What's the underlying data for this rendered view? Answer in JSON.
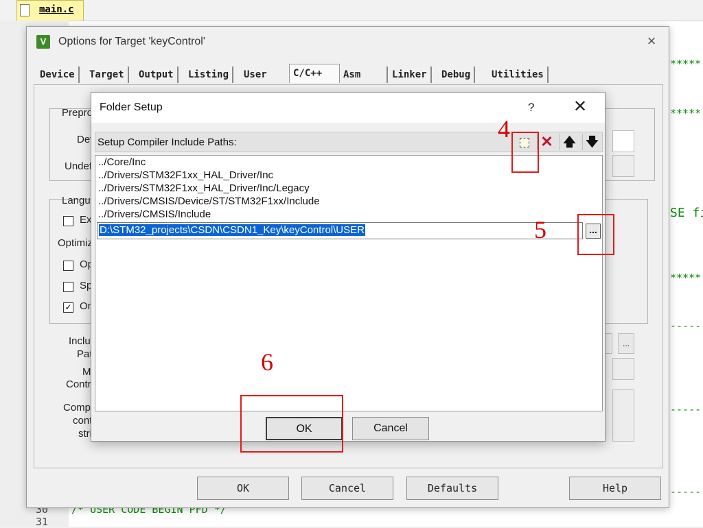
{
  "editor": {
    "file_tab": "main.c",
    "code_fragments": [
      "*****",
      "*****",
      "SE fi",
      "*****",
      "-----",
      "-----",
      "-----",
      "/* USER CODE BEGIN PFD */"
    ],
    "line_numbers": [
      "30",
      "31"
    ]
  },
  "options_dialog": {
    "title": "Options for Target 'keyControl'",
    "close_glyph": "×",
    "tabs": [
      "Device",
      "Target",
      "Output",
      "Listing",
      "User",
      "C/C++",
      "Asm",
      "Linker",
      "Debug",
      "Utilities"
    ],
    "active_tab": "C/C++",
    "bg_labels": [
      "Prepro",
      "Def",
      "Undef",
      "Langu",
      "Ex",
      "Optimiz",
      "Op",
      "Sp",
      "On",
      "Inclu",
      "Pat",
      "M",
      "Contr",
      "Comp",
      "cont",
      "stri"
    ],
    "bg_browse_glyph": "...",
    "buttons": {
      "ok": "OK",
      "cancel": "Cancel",
      "defaults": "Defaults",
      "help": "Help"
    }
  },
  "folder_setup": {
    "title": "Folder Setup",
    "help_glyph": "?",
    "close_glyph": "✕",
    "toolbar_label": "Setup Compiler Include Paths:",
    "toolbar_icons": [
      "new-folder-icon",
      "delete-icon",
      "move-up-icon",
      "move-down-icon"
    ],
    "paths": [
      "../Core/Inc",
      "../Drivers/STM32F1xx_HAL_Driver/Inc",
      "../Drivers/STM32F1xx_HAL_Driver/Inc/Legacy",
      "../Drivers/CMSIS/Device/ST/STM32F1xx/Include",
      "../Drivers/CMSIS/Include"
    ],
    "editing_path": "D:\\STM32_projects\\CSDN\\CSDN1_Key\\keyControl\\USER",
    "browse_glyph": "...",
    "ok_label": "OK",
    "cancel_label": "Cancel"
  },
  "annotations": {
    "step4": "4",
    "step5": "5",
    "step6": "6",
    "color": "#e01b1b"
  }
}
